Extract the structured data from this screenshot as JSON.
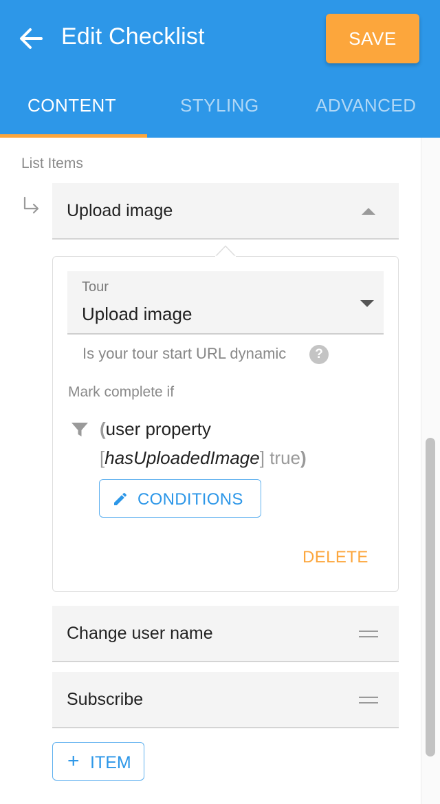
{
  "header": {
    "title": "Edit Checklist",
    "save_label": "SAVE",
    "colors": {
      "background": "#2d97e8",
      "accent": "#fca63c"
    }
  },
  "tabs": [
    {
      "label": "CONTENT",
      "active": true
    },
    {
      "label": "STYLING",
      "active": false
    },
    {
      "label": "ADVANCED",
      "active": false
    }
  ],
  "list": {
    "section_label": "List Items",
    "items": [
      {
        "label": "Upload image",
        "expanded": true
      },
      {
        "label": "Change user name",
        "expanded": false
      },
      {
        "label": "Subscribe",
        "expanded": false
      }
    ],
    "add_label": "ITEM"
  },
  "panel": {
    "tour_field_label": "Tour",
    "tour_field_value": "Upload image",
    "dynamic_url_text": "Is your tour start URL dynamic",
    "mark_complete_label": "Mark complete if",
    "condition": {
      "open_paren": "(",
      "subject": "user property",
      "open_bracket": "[",
      "property": "hasUploadedImage",
      "close_bracket": "]",
      "value": "true",
      "close_paren": ")"
    },
    "conditions_button_label": "CONDITIONS",
    "delete_label": "DELETE"
  },
  "icons": {
    "back": "arrow-left-icon",
    "sub_item": "subdirectory-arrow-icon",
    "collapse": "caret-up-icon",
    "dropdown": "caret-down-icon",
    "help": "question-circle-icon",
    "help_glyph": "?",
    "filter": "filter-funnel-icon",
    "edit": "pencil-icon",
    "drag": "drag-handle-icon",
    "add": "plus-icon",
    "add_glyph": "+"
  }
}
